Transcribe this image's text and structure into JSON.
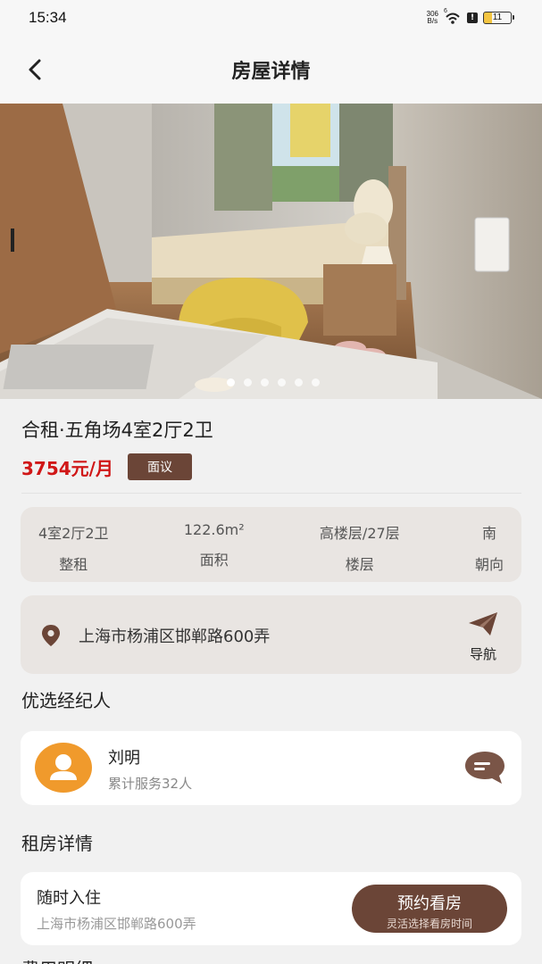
{
  "status_bar": {
    "time": "15:34",
    "net_speed_top": "306",
    "net_speed_bottom": "B/s",
    "signal_label": "6",
    "battery_level": "11",
    "icons": [
      "wifi-icon",
      "alert-icon",
      "battery-icon"
    ]
  },
  "nav": {
    "title": "房屋详情",
    "back_icon": "chevron-left-icon"
  },
  "gallery": {
    "image_description": "bedroom photo",
    "dot_count": 6,
    "active_index": 0
  },
  "listing": {
    "title": "合租·五角场4室2厅2卫",
    "price": "3754元/月",
    "negotiable_label": "面议"
  },
  "specs": [
    {
      "value": "4室2厅2卫",
      "label": "整租"
    },
    {
      "value": "122.6m²",
      "label": "面积"
    },
    {
      "value": "高楼层/27层",
      "label": "楼层"
    },
    {
      "value": "南",
      "label": "朝向"
    }
  ],
  "address": {
    "text": "上海市杨浦区邯郸路600弄",
    "navigate_label": "导航",
    "pin_icon": "location-pin-icon",
    "navigate_icon": "paper-plane-icon"
  },
  "agent_section": {
    "title": "优选经纪人",
    "name": "刘明",
    "stat": "累计服务32人",
    "chat_icon": "chat-bubble-icon"
  },
  "rent_section": {
    "title": "租房详情",
    "move_in": "随时入住",
    "address": "上海市杨浦区邯郸路600弄",
    "book_label": "预约看房",
    "book_sub": "灵活选择看房时间"
  },
  "next_section": {
    "title": "费用明细"
  },
  "colors": {
    "accent_brown": "#6b4537",
    "price_red": "#d01717",
    "card_beige": "#e9e5e2",
    "avatar_orange": "#f09a2c"
  }
}
